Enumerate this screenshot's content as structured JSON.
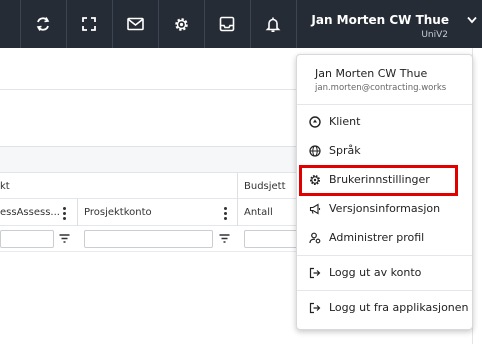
{
  "topbar": {
    "user_name": "Jan Morten CW Thue",
    "company": "UniV2",
    "icons": [
      "refresh-icon",
      "fullscreen-icon",
      "mail-icon",
      "gear-icon",
      "inbox-icon",
      "bell-icon",
      "chevron-down-icon"
    ]
  },
  "table": {
    "group_headers": [
      "kt",
      "Budsjett"
    ],
    "columns": [
      "essAssess...",
      "Prosjektkonto",
      "Antall"
    ]
  },
  "user_menu": {
    "name": "Jan Morten CW Thue",
    "email": "jan.morten@contracting.works",
    "items": [
      {
        "label": "Klient",
        "icon": "client-icon"
      },
      {
        "label": "Språk",
        "icon": "globe-icon"
      },
      {
        "label": "Brukerinnstillinger",
        "icon": "gear-icon"
      },
      {
        "label": "Versjonsinformasjon",
        "icon": "megaphone-icon"
      },
      {
        "label": "Administrer profil",
        "icon": "user-settings-icon"
      },
      {
        "label": "Logg ut av konto",
        "icon": "logout-icon"
      },
      {
        "label": "Logg ut fra applikasjonen",
        "icon": "logout-icon"
      }
    ],
    "highlighted_item": "Brukerinnstillinger",
    "highlight_color": "#e00000"
  },
  "colors": {
    "topbar_bg": "#262c36",
    "topbar_text": "#ffffff"
  }
}
